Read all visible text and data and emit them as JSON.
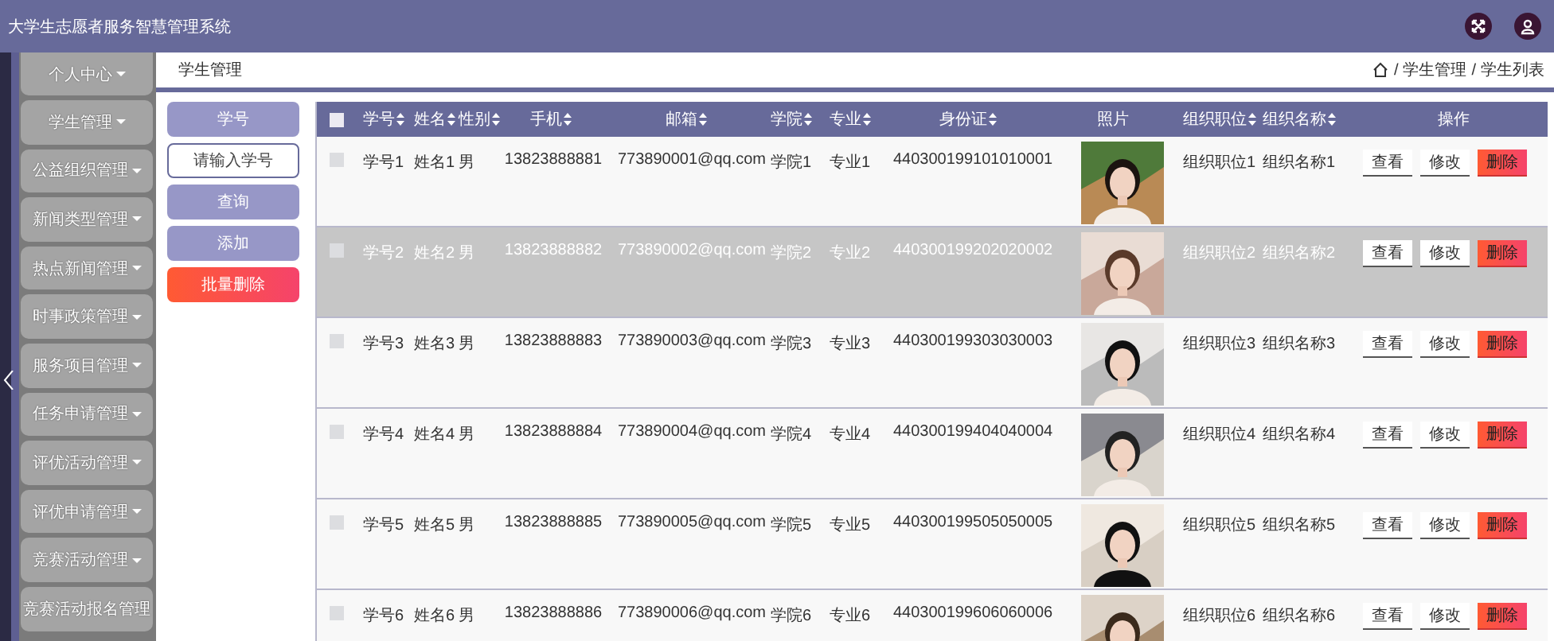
{
  "app_title": "大学生志愿者服务智慧管理系统",
  "sidebar": {
    "items": [
      {
        "label": "个人中心",
        "has_caret": true
      },
      {
        "label": "学生管理",
        "has_caret": true
      },
      {
        "label": "公益组织管理",
        "has_caret": true
      },
      {
        "label": "新闻类型管理",
        "has_caret": true
      },
      {
        "label": "热点新闻管理",
        "has_caret": true
      },
      {
        "label": "时事政策管理",
        "has_caret": true
      },
      {
        "label": "服务项目管理",
        "has_caret": true
      },
      {
        "label": "任务申请管理",
        "has_caret": true
      },
      {
        "label": "评优活动管理",
        "has_caret": true
      },
      {
        "label": "评优申请管理",
        "has_caret": true
      },
      {
        "label": "竞赛活动管理",
        "has_caret": true
      },
      {
        "label": "竞赛活动报名管理",
        "has_caret": false
      }
    ]
  },
  "page_title": "学生管理",
  "breadcrumb": {
    "separator": "/",
    "items": [
      "学生管理",
      "学生列表"
    ]
  },
  "search": {
    "label": "学号",
    "placeholder": "请输入学号",
    "buttons": [
      {
        "label": "查询",
        "kind": "primary"
      },
      {
        "label": "添加",
        "kind": "primary"
      },
      {
        "label": "批量删除",
        "kind": "danger"
      }
    ]
  },
  "table": {
    "header_checked": false,
    "columns": [
      {
        "label": "学号",
        "sortable": true
      },
      {
        "label": "姓名",
        "sortable": true
      },
      {
        "label": "性别",
        "sortable": true
      },
      {
        "label": "手机",
        "sortable": true
      },
      {
        "label": "邮箱",
        "sortable": true
      },
      {
        "label": "学院",
        "sortable": true
      },
      {
        "label": "专业",
        "sortable": true
      },
      {
        "label": "身份证",
        "sortable": true
      },
      {
        "label": "照片",
        "sortable": false
      },
      {
        "label": "组织职位",
        "sortable": true
      },
      {
        "label": "组织名称",
        "sortable": true
      },
      {
        "label": "操作",
        "sortable": false
      }
    ],
    "rows": [
      {
        "checked": false,
        "highlighted": false,
        "cells": [
          "学号1",
          "姓名1",
          "男",
          "13823888881",
          "773890001@qq.com",
          "学院1",
          "专业1",
          "440300199101010001"
        ],
        "photo": {
          "kind": "picture"
        },
        "org": [
          "组织职位1",
          "组织名称1"
        ],
        "actions": [
          {
            "label": "查看",
            "kind": "plain"
          },
          {
            "label": "修改",
            "kind": "plain"
          },
          {
            "label": "删除",
            "kind": "danger"
          }
        ]
      },
      {
        "checked": false,
        "highlighted": true,
        "cells": [
          "学号2",
          "姓名2",
          "男",
          "13823888882",
          "773890002@qq.com",
          "学院2",
          "专业2",
          "440300199202020002"
        ],
        "photo": {
          "kind": "picture"
        },
        "org": [
          "组织职位2",
          "组织名称2"
        ],
        "actions": [
          {
            "label": "查看",
            "kind": "plain"
          },
          {
            "label": "修改",
            "kind": "plain"
          },
          {
            "label": "删除",
            "kind": "danger"
          }
        ]
      },
      {
        "checked": false,
        "highlighted": false,
        "cells": [
          "学号3",
          "姓名3",
          "男",
          "13823888883",
          "773890003@qq.com",
          "学院3",
          "专业3",
          "440300199303030003"
        ],
        "photo": {
          "kind": "picture"
        },
        "org": [
          "组织职位3",
          "组织名称3"
        ],
        "actions": [
          {
            "label": "查看",
            "kind": "plain"
          },
          {
            "label": "修改",
            "kind": "plain"
          },
          {
            "label": "删除",
            "kind": "danger"
          }
        ]
      },
      {
        "checked": false,
        "highlighted": false,
        "cells": [
          "学号4",
          "姓名4",
          "男",
          "13823888884",
          "773890004@qq.com",
          "学院4",
          "专业4",
          "440300199404040004"
        ],
        "photo": {
          "kind": "picture"
        },
        "org": [
          "组织职位4",
          "组织名称4"
        ],
        "actions": [
          {
            "label": "查看",
            "kind": "plain"
          },
          {
            "label": "修改",
            "kind": "plain"
          },
          {
            "label": "删除",
            "kind": "danger"
          }
        ]
      },
      {
        "checked": false,
        "highlighted": false,
        "cells": [
          "学号5",
          "姓名5",
          "男",
          "13823888885",
          "773890005@qq.com",
          "学院5",
          "专业5",
          "440300199505050005"
        ],
        "photo": {
          "kind": "picture"
        },
        "org": [
          "组织职位5",
          "组织名称5"
        ],
        "actions": [
          {
            "label": "查看",
            "kind": "plain"
          },
          {
            "label": "修改",
            "kind": "plain"
          },
          {
            "label": "删除",
            "kind": "danger"
          }
        ]
      },
      {
        "checked": false,
        "highlighted": false,
        "cells": [
          "学号6",
          "姓名6",
          "男",
          "13823888886",
          "773890006@qq.com",
          "学院6",
          "专业6",
          "440300199606060006"
        ],
        "photo": {
          "kind": "picture"
        },
        "org": [
          "组织职位6",
          "组织名称6"
        ],
        "actions": [
          {
            "label": "查看",
            "kind": "plain"
          },
          {
            "label": "修改",
            "kind": "plain"
          },
          {
            "label": "删除",
            "kind": "danger"
          }
        ]
      }
    ]
  }
}
